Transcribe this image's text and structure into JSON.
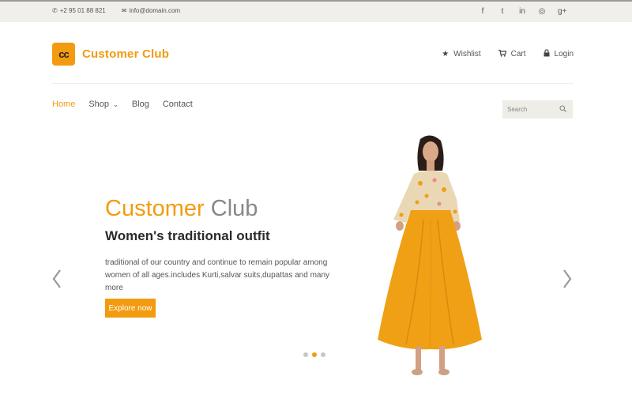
{
  "topbar": {
    "phone": "+2 95 01 88 821",
    "email": "info@domain.com",
    "social": [
      {
        "glyph": "f",
        "icon": "facebook-icon"
      },
      {
        "glyph": "t",
        "icon": "twitter-icon"
      },
      {
        "glyph": "in",
        "icon": "linkedin-icon"
      },
      {
        "glyph": "◎",
        "icon": "dribbble-icon"
      },
      {
        "glyph": "g+",
        "icon": "google-plus-icon"
      }
    ]
  },
  "header": {
    "logo_badge": "cc",
    "logo_text": "Customer Club",
    "links": {
      "wishlist": "Wishlist",
      "cart": "Cart",
      "login": "Login"
    }
  },
  "nav": {
    "home": "Home",
    "shop": "Shop",
    "blog": "Blog",
    "contact": "Contact"
  },
  "search": {
    "placeholder": "Search"
  },
  "hero": {
    "title_part1": "Customer",
    "title_part2": "Club",
    "subtitle": "Women's traditional outfit",
    "description": "traditional of our country and continue to remain popular among women of all ages.includes Kurti,salvar suits,dupattas and many more",
    "button_label": "Explore now"
  },
  "slider": {
    "slide_count": 3,
    "active_index": 1
  },
  "colors": {
    "accent": "#f29b10",
    "topbar_bg": "#f1efe9",
    "dress": "#f0a015"
  }
}
